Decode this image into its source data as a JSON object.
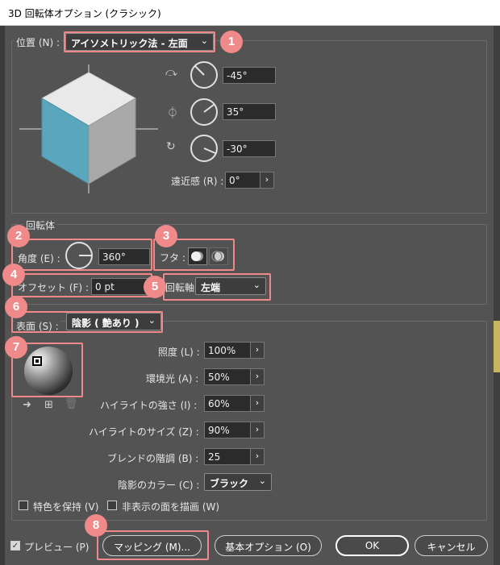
{
  "window": {
    "title": "3D 回転体オプション (クラシック)"
  },
  "position": {
    "label": "位置 (N) :",
    "preset": "アイソメトリック法 - 左面",
    "rot_x": "-45°",
    "rot_y": "35°",
    "rot_z": "-30°",
    "perspective_label": "遠近感 (R) :",
    "perspective": "0°"
  },
  "revolve": {
    "group_label": "回転体",
    "angle_label": "角度 (E) :",
    "angle": "360°",
    "cap_label": "フタ :",
    "offset_label": "オフセット (F) :",
    "offset": "0 pt",
    "axis_label": "回転軸",
    "axis": "左端"
  },
  "surface": {
    "label": "表面 (S) :",
    "value": "陰影 ( 艶あり )",
    "light_intensity_label": "照度 (L) :",
    "light_intensity": "100%",
    "ambient_label": "環境光 (A) :",
    "ambient": "50%",
    "highlight_intensity_label": "ハイライトの強さ (I) :",
    "highlight_intensity": "60%",
    "highlight_size_label": "ハイライトのサイズ (Z) :",
    "highlight_size": "90%",
    "blend_steps_label": "ブレンドの階調 (B) :",
    "blend_steps": "25",
    "shade_color_label": "陰影のカラー (C) :",
    "shade_color": "ブラック",
    "preserve_spot_label": "特色を保持 (V)",
    "draw_hidden_label": "非表示の面を描画 (W)"
  },
  "footer": {
    "preview_label": "プレビュー (P)",
    "mapping_button": "マッピング (M)...",
    "basic_options_button": "基本オプション (O)",
    "ok_button": "OK",
    "cancel_button": "キャンセル"
  },
  "annotations": [
    "1",
    "2",
    "3",
    "4",
    "5",
    "6",
    "7",
    "8"
  ],
  "colors": {
    "badge": "#f08a8a",
    "cube_left": "#5aa6bd",
    "cube_top": "#e9e9e9",
    "cube_right": "#a9a9a9",
    "background": "#535353"
  }
}
